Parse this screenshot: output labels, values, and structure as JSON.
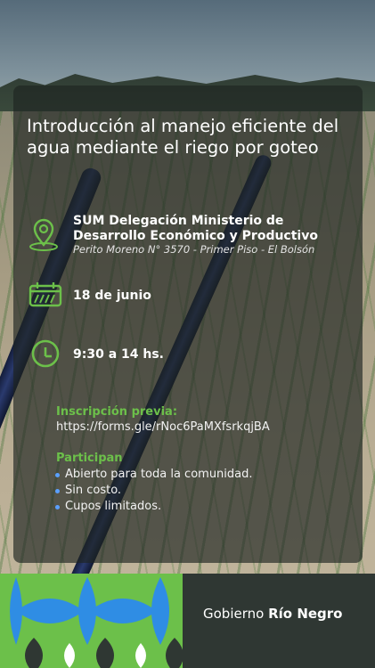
{
  "title": "Introducción al manejo eficiente del agua mediante el riego por goteo",
  "location": {
    "icon": "location-pin-icon",
    "name": "SUM Delegación Ministerio de Desarrollo Económico y Productivo",
    "address": "Perito Moreno N° 3570 - Primer Piso - El Bolsón"
  },
  "date": {
    "icon": "calendar-icon",
    "text": "18 de junio"
  },
  "time": {
    "icon": "clock-icon",
    "text": "9:30 a 14 hs."
  },
  "registration": {
    "label": "Inscripción previa:",
    "url": "https://forms.gle/rNoc6PaMXfsrkqjBA"
  },
  "participants": {
    "label": "Participan",
    "items": [
      "Abierto para toda la comunidad.",
      "Sin costo.",
      "Cupos limitados."
    ]
  },
  "footer": {
    "prefix": "Gobierno",
    "name": "Río Negro"
  },
  "colors": {
    "accent": "#6cc04a",
    "blue": "#2f8de4",
    "panel": "#1e2422",
    "bullet": "#5aa0ff"
  }
}
